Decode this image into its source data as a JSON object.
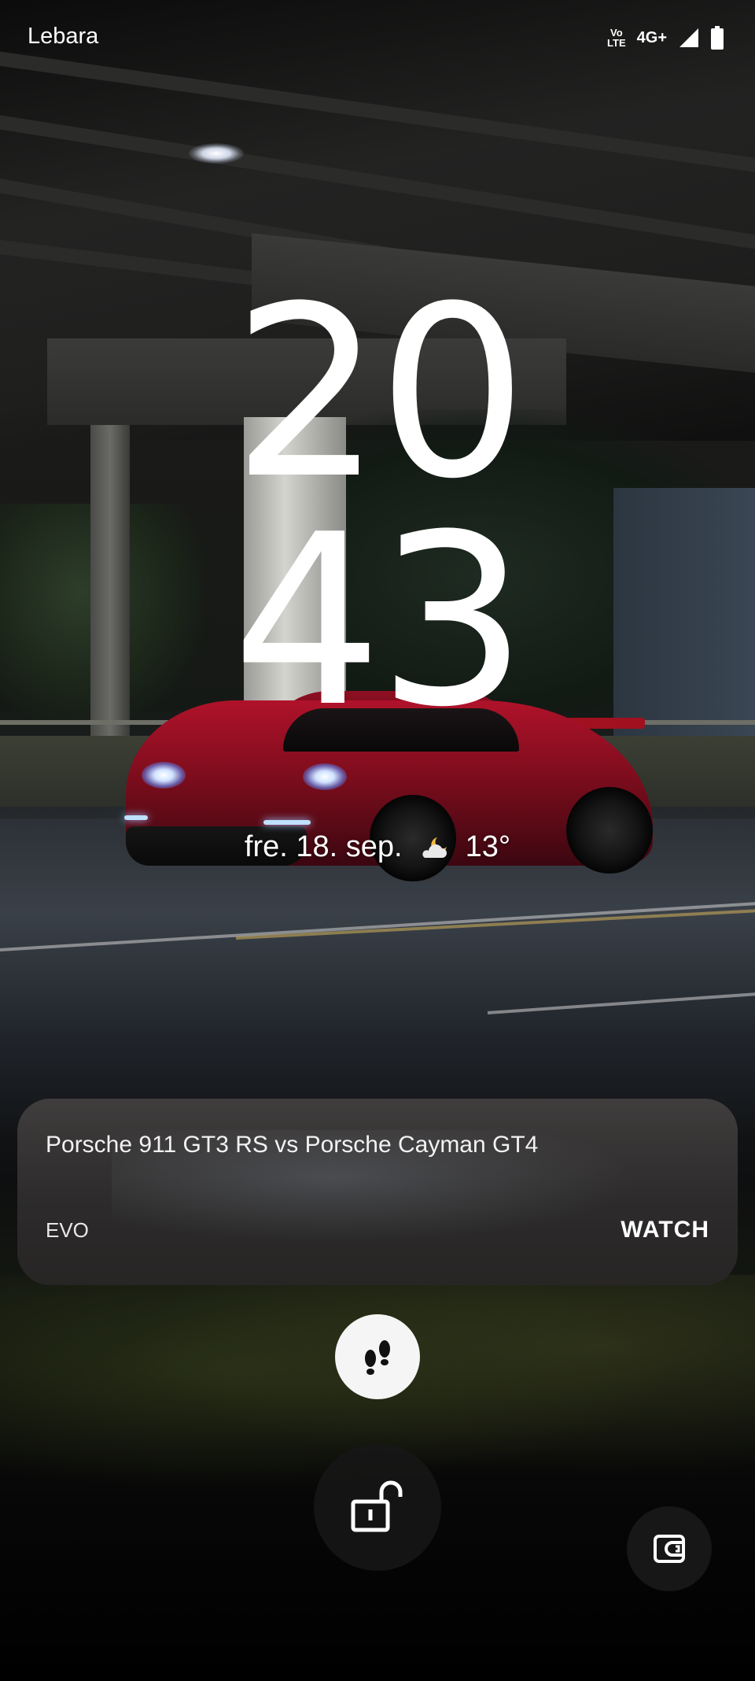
{
  "status_bar": {
    "carrier": "Lebara",
    "volte_top": "Vo",
    "volte_bottom": "LTE",
    "network_type": "4G+",
    "icons": [
      "volte-icon",
      "signal-icon",
      "battery-icon"
    ]
  },
  "clock": {
    "hours": "20",
    "minutes": "43"
  },
  "date_weather": {
    "date": "fre. 18. sep.",
    "weather_icon": "partly-cloudy-night-icon",
    "temperature": "13°"
  },
  "media_notification": {
    "title": "Porsche 911 GT3 RS vs Porsche Cayman GT4",
    "source": "EVO",
    "action": "WATCH"
  },
  "shortcuts": {
    "center_icon": "footsteps-icon",
    "unlock_icon": "unlock-icon",
    "wallet_icon": "wallet-icon"
  },
  "colors": {
    "text": "#ffffff",
    "card_background": "#3e3b3b",
    "button_light": "#f5f5f5",
    "button_dark": "#161616"
  }
}
